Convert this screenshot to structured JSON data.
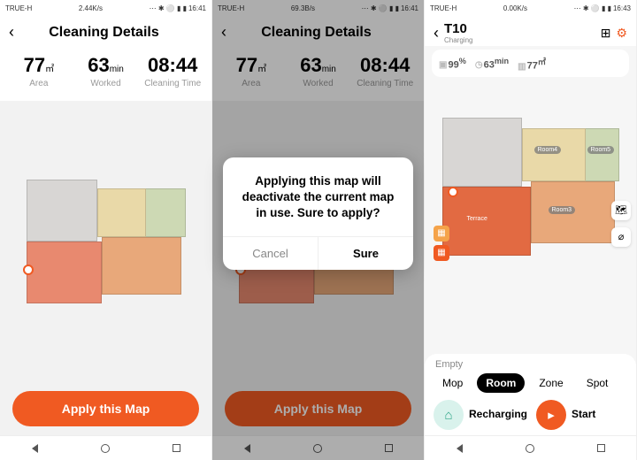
{
  "status": {
    "carrier": "TRUE-H",
    "speed1": "2.44K/s",
    "speed2": "69.3B/s",
    "speed3": "0.00K/s",
    "time1": "16:41",
    "time2": "16:41",
    "time3": "16:43",
    "icons": "⋯ ✱ ⚪ ▮ ▮"
  },
  "screen1": {
    "title": "Cleaning Details",
    "area_val": "77",
    "area_unit": "㎡",
    "area_lbl": "Area",
    "worked_val": "63",
    "worked_unit": "min",
    "worked_lbl": "Worked",
    "time_val": "08:44",
    "time_lbl": "Cleaning Time",
    "apply": "Apply this Map"
  },
  "dialog": {
    "msg": "Applying this map will deactivate the current map in use. Sure to apply?",
    "cancel": "Cancel",
    "sure": "Sure"
  },
  "screen3": {
    "title": "T10",
    "subtitle": "Charging",
    "battery": "99",
    "battery_unit": "%",
    "mins": "63",
    "mins_unit": "min",
    "area": "77",
    "area_unit": "㎡",
    "rooms": {
      "r4": "Room4",
      "r5": "Room5",
      "r3": "Room3",
      "terrace": "Terrace"
    },
    "empty": "Empty",
    "modes": {
      "mop": "Mop",
      "room": "Room",
      "zone": "Zone",
      "spot": "Spot"
    },
    "recharge": "Recharging",
    "start": "Start"
  }
}
